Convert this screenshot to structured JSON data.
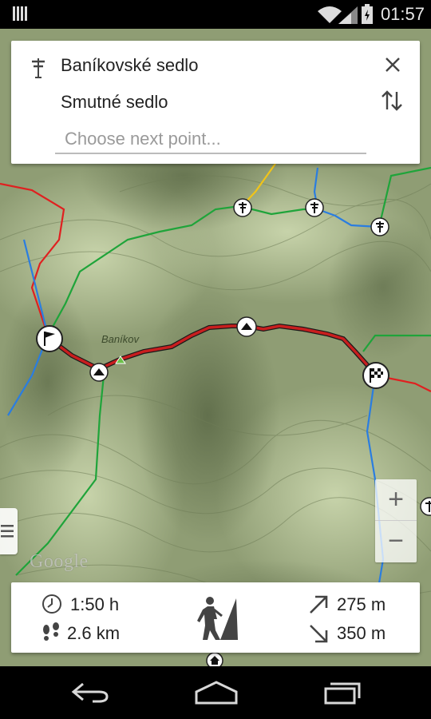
{
  "status_bar": {
    "time": "01:57"
  },
  "route": {
    "from": "Baníkovské sedlo",
    "to": "Smutné sedlo",
    "next_placeholder": "Choose next point..."
  },
  "map": {
    "peak_label": "Baníkov",
    "attribution": "Google"
  },
  "zoom": {
    "in_label": "+",
    "out_label": "−"
  },
  "stats": {
    "duration": "1:50 h",
    "distance": "2.6 km",
    "ascent": "275 m",
    "descent": "350 m"
  },
  "colors": {
    "route": "#c81e1e",
    "trail_red": "#e02020",
    "trail_green": "#1fa43a",
    "trail_blue": "#2a7de0",
    "trail_yellow": "#f0c419",
    "terrain": "#8f9d74"
  }
}
